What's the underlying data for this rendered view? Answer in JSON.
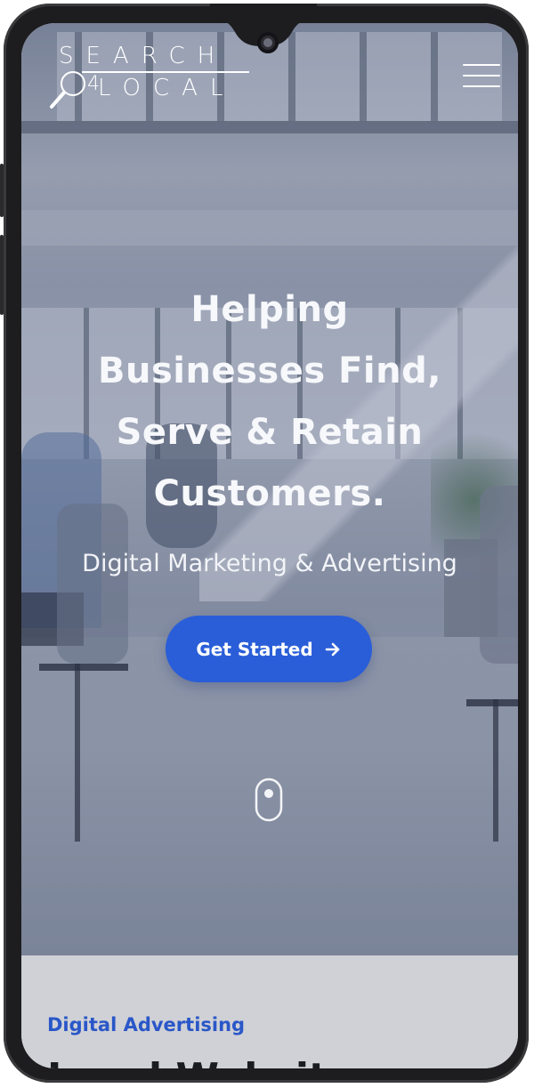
{
  "brand": {
    "logo_line1": "SEARCH",
    "logo_badge": "4",
    "logo_line2": "LOCAL"
  },
  "nav": {
    "menu_icon": "hamburger-menu-icon"
  },
  "hero": {
    "headline_lines": [
      "Helping",
      "Businesses Find,",
      "Serve & Retain",
      "Customers."
    ],
    "subheadline": "Digital Marketing & Advertising",
    "cta_label": "Get Started",
    "cta_icon": "arrow-right-icon",
    "scroll_icon": "mouse-scroll-icon"
  },
  "next_section": {
    "kicker": "Digital Advertising",
    "heading_partial": "Local Websit"
  },
  "colors": {
    "accent": "#2a5ed8",
    "kicker": "#2a57c8",
    "device_frame": "#1d1d1f"
  }
}
